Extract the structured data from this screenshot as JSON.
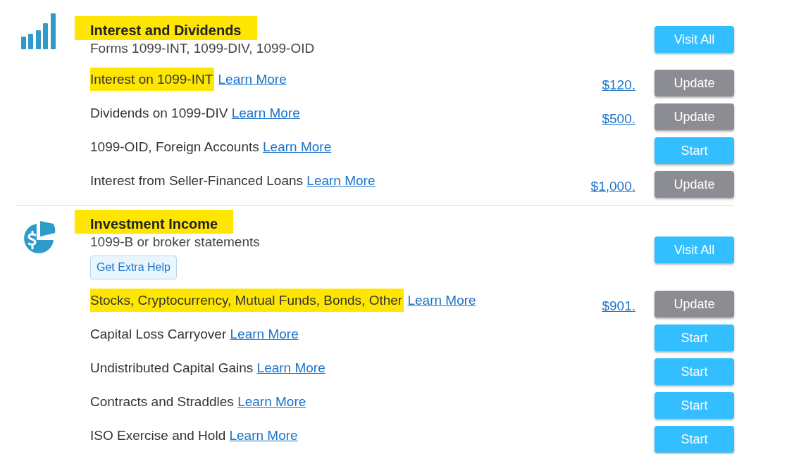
{
  "sections": [
    {
      "kind": "bars",
      "title": "Interest and Dividends",
      "title_highlighted": true,
      "subtitle": "Forms 1099-INT, 1099-DIV, 1099-OID",
      "visit_all": "Visit All",
      "rows": [
        {
          "label": "Interest on 1099-INT",
          "highlighted": true,
          "link": "Learn More",
          "amount": "$120.",
          "kind": "update",
          "button": "Update"
        },
        {
          "label": "Dividends on 1099-DIV",
          "highlighted": false,
          "link": "Learn More",
          "amount": "$500.",
          "kind": "update",
          "button": "Update"
        },
        {
          "label": "1099-OID, Foreign Accounts",
          "highlighted": false,
          "link": "Learn More",
          "kind": "start",
          "button": "Start"
        },
        {
          "label": "Interest from Seller-Financed Loans",
          "highlighted": false,
          "link": "Learn More",
          "amount": "$1,000.",
          "kind": "update",
          "button": "Update"
        }
      ]
    },
    {
      "kind": "pie",
      "title": "Investment Income",
      "title_highlighted": true,
      "subtitle": "1099-B or broker statements",
      "help": "Get Extra Help",
      "visit_all": "Visit All",
      "rows": [
        {
          "label": "Stocks, Cryptocurrency, Mutual Funds, Bonds, Other",
          "highlighted": true,
          "link": "Learn More",
          "amount": "$901.",
          "kind": "update",
          "button": "Update"
        },
        {
          "label": "Capital Loss Carryover",
          "highlighted": false,
          "link": "Learn More",
          "kind": "start",
          "button": "Start"
        },
        {
          "label": "Undistributed Capital Gains",
          "highlighted": false,
          "link": "Learn More",
          "kind": "start",
          "button": "Start"
        },
        {
          "label": "Contracts and Straddles",
          "highlighted": false,
          "link": "Learn More",
          "kind": "start",
          "button": "Start"
        },
        {
          "label": "ISO Exercise and Hold",
          "highlighted": false,
          "link": "Learn More",
          "kind": "start",
          "button": "Start"
        }
      ]
    }
  ]
}
